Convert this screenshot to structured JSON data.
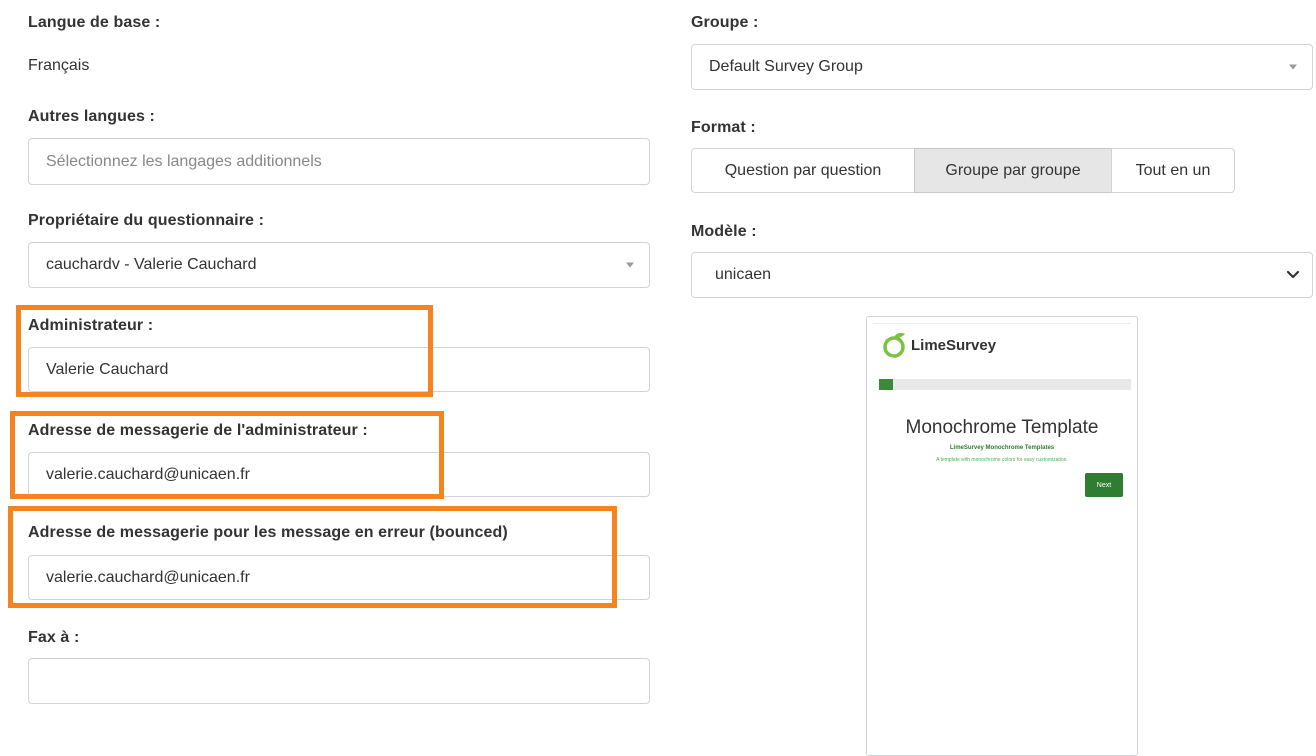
{
  "left": {
    "base_language": {
      "label": "Langue de base :",
      "value": "Français"
    },
    "other_languages": {
      "label": "Autres langues :",
      "placeholder": "Sélectionnez les langages additionnels"
    },
    "owner": {
      "label": "Propriétaire du questionnaire :",
      "value": "cauchardv - Valerie Cauchard"
    },
    "admin": {
      "label": "Administrateur :",
      "value": "Valerie Cauchard"
    },
    "admin_email": {
      "label": "Adresse de messagerie de l'administrateur :",
      "value": "valerie.cauchard@unicaen.fr"
    },
    "bounce_email": {
      "label": "Adresse de messagerie pour les message en erreur (bounced)",
      "value": "valerie.cauchard@unicaen.fr"
    },
    "fax": {
      "label": "Fax à :",
      "value": ""
    }
  },
  "right": {
    "group": {
      "label": "Groupe :",
      "value": "Default Survey Group"
    },
    "format": {
      "label": "Format :",
      "options": [
        "Question par question",
        "Groupe par groupe",
        "Tout en un"
      ],
      "selected": "Groupe par groupe"
    },
    "template": {
      "label": "Modèle :",
      "value": "unicaen"
    },
    "preview": {
      "logo_text": "LimeSurvey",
      "title": "Monochrome Template",
      "subtitle": "LimeSurvey Monochrome Templates",
      "description": "A template with monochrome colors for easy customization.",
      "next_label": "Next"
    }
  },
  "colors": {
    "highlight": "#f58320",
    "border": "#cfd4da",
    "active_segment": "#e6e6e6",
    "brand_green": "#2e7d32"
  },
  "icons": {
    "select_caret": "caret-down-icon",
    "template_select": "chevron-down-icon",
    "logo": "limesurvey-logo-icon"
  }
}
